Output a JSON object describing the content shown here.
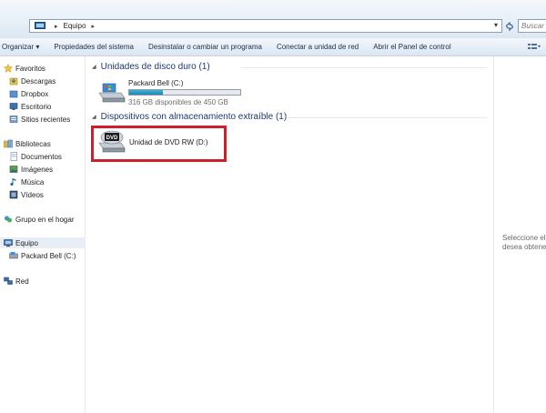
{
  "address_bar": {
    "path": [
      "Equipo"
    ],
    "search_placeholder": "Buscar"
  },
  "command_bar": {
    "items": [
      "Organizar ▾",
      "Propiedades del sistema",
      "Desinstalar o cambiar un programa",
      "Conectar a unidad de red",
      "Abrir el Panel de control"
    ]
  },
  "nav": {
    "favorites": "Favoritos",
    "descargas": "Descargas",
    "dropbox": "Dropbox",
    "escritorio": "Escritorio",
    "sitios": "Sitios recientes",
    "bibliotecas": "Bibliotecas",
    "documentos": "Documentos",
    "imagenes": "Imágenes",
    "musica": "Música",
    "videos": "Vídeos",
    "grupo": "Grupo en el hogar",
    "equipo": "Equipo",
    "packard": "Packard Bell (C:)",
    "red": "Red"
  },
  "content": {
    "group_hdd": "Unidades de disco duro (1)",
    "drive_c": {
      "name": "Packard Bell (C:)",
      "free_text": "316 GB disponibles de 450 GB",
      "used_fraction": 0.3
    },
    "group_removable": "Dispositivos con almacenamiento extraíble (1)",
    "drive_d": {
      "name": "Unidad de DVD RW (D:)",
      "icon_label": "DVD"
    }
  },
  "details": {
    "line1": "Seleccione el e",
    "line2": "desea obtener"
  },
  "colors": {
    "highlight": "#cc1f2a",
    "progress": "#26a0cb"
  }
}
